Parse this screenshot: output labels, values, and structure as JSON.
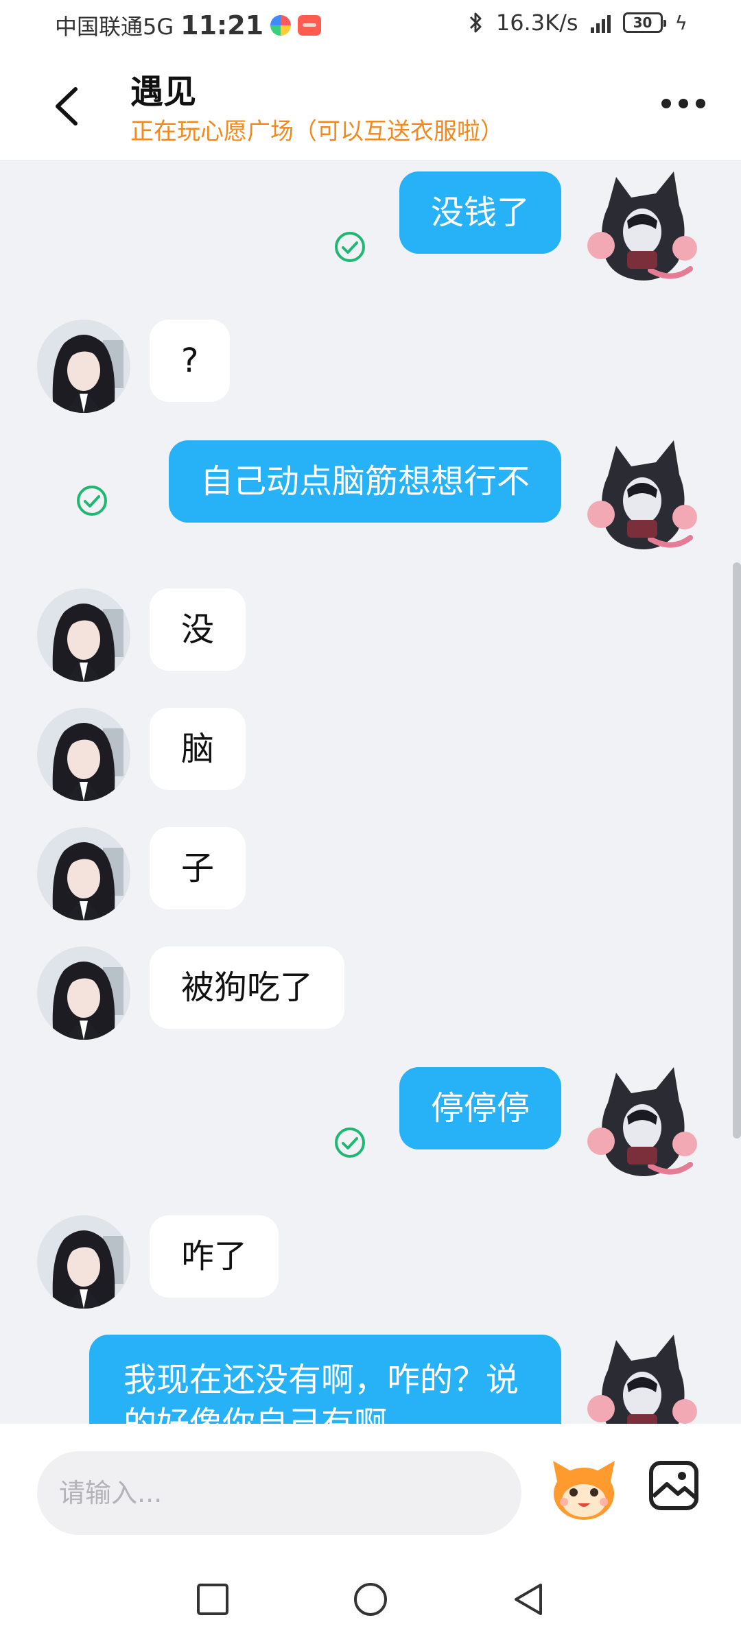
{
  "status_bar": {
    "carrier": "中国联通5G",
    "time": "11:21",
    "net_speed": "16.3K/s",
    "network_tag": "5G",
    "battery": "30"
  },
  "header": {
    "title": "遇见",
    "subtitle": "正在玩心愿广场（可以互送衣服啦）"
  },
  "messages": [
    {
      "side": "out",
      "text": "没钱了",
      "read": true
    },
    {
      "side": "in",
      "text": "?"
    },
    {
      "side": "out",
      "text": "自己动点脑筋想想行不",
      "read": true
    },
    {
      "side": "in",
      "text": "没"
    },
    {
      "side": "in",
      "text": "脑"
    },
    {
      "side": "in",
      "text": "子"
    },
    {
      "side": "in",
      "text": "被狗吃了"
    },
    {
      "side": "out",
      "text": "停停停",
      "read": true
    },
    {
      "side": "in",
      "text": "咋了"
    },
    {
      "side": "out",
      "text": "我现在还没有啊，咋的？说的好像你自己有啊",
      "read": false
    }
  ],
  "input": {
    "placeholder": "请输入..."
  },
  "icons": {
    "back": "back-arrow-icon",
    "more": "more-dots-icon",
    "read": "read-check-icon",
    "emoji": "mascot-emoji-icon",
    "image": "image-picker-icon"
  },
  "colors": {
    "outgoing_bubble": "#27b1f6",
    "incoming_bubble": "#ffffff",
    "subtitle": "#f08a1e",
    "read_check": "#1fb873",
    "background": "#f0f2f6"
  }
}
